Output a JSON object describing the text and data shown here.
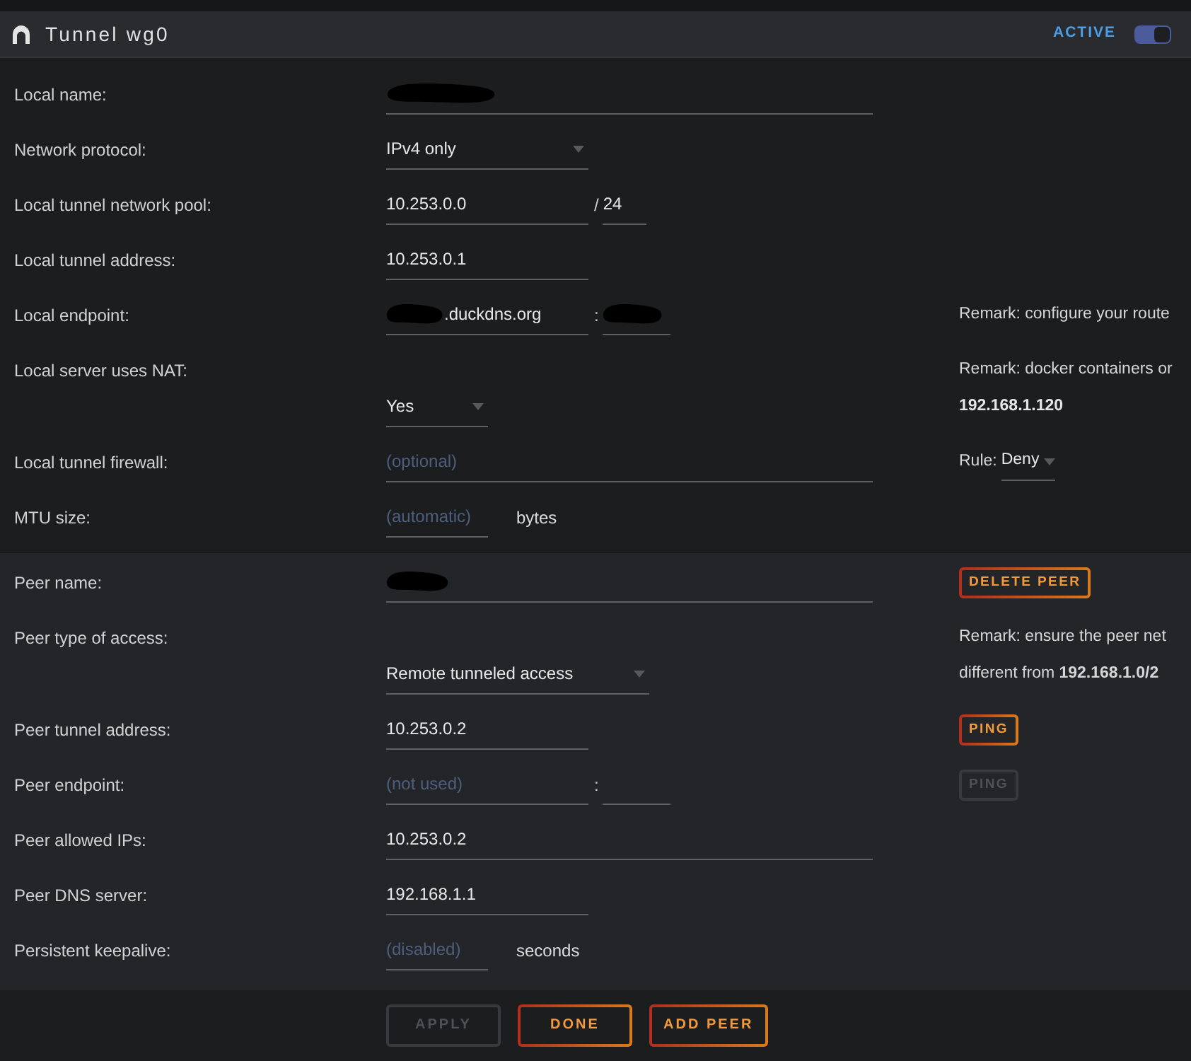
{
  "header": {
    "title": "Tunnel wg0",
    "status": "ACTIVE",
    "toggle_on": true
  },
  "sections": [
    {
      "rows": [
        {
          "label": "Local name:",
          "fields": [
            {
              "kind": "input",
              "redacted": true
            }
          ]
        },
        {
          "label": "Network protocol:",
          "fields": [
            {
              "kind": "select",
              "value": "IPv4 only"
            }
          ]
        },
        {
          "label": "Local tunnel network pool:",
          "fields": [
            {
              "kind": "input",
              "value": "10.253.0.0",
              "redacted": false
            },
            {
              "kind": "separator",
              "text": "/"
            },
            {
              "kind": "input",
              "value": "24",
              "redacted": false
            }
          ]
        },
        {
          "label": "Local tunnel address:",
          "fields": [
            {
              "kind": "input",
              "value": "10.253.0.1",
              "redacted": false
            }
          ]
        },
        {
          "label": "Local endpoint:",
          "fields": [
            {
              "kind": "input",
              "value": ".duckdns.org",
              "redacted": true
            },
            {
              "kind": "separator",
              "text": ":"
            },
            {
              "kind": "input",
              "redacted": true
            }
          ],
          "side": [
            {
              "kind": "remark",
              "text": "Remark: configure your route"
            }
          ]
        },
        {
          "label": "Local server uses NAT:",
          "fields": [
            {
              "kind": "select",
              "value": "Yes"
            }
          ],
          "side": [
            {
              "kind": "remark",
              "text": "Remark: docker containers or"
            },
            {
              "kind": "address",
              "text": "192.168.1.120"
            }
          ]
        },
        {
          "label": "Local tunnel firewall:",
          "fields": [
            {
              "kind": "input",
              "placeholder": "(optional)",
              "redacted": false
            }
          ],
          "side": [
            {
              "kind": "rule",
              "label": "Rule:",
              "value": "Deny"
            }
          ]
        },
        {
          "label": "MTU size:",
          "fields": [
            {
              "kind": "input",
              "placeholder": "(automatic)",
              "redacted": false
            },
            {
              "kind": "unit",
              "text": "bytes"
            }
          ]
        }
      ]
    },
    {
      "rows": [
        {
          "label": "Peer name:",
          "fields": [
            {
              "kind": "input",
              "redacted": true
            }
          ],
          "side": [
            {
              "kind": "button",
              "label": "DELETE PEER",
              "disabled": false
            }
          ]
        },
        {
          "label": "Peer type of access:",
          "fields": [
            {
              "kind": "select",
              "value": "Remote tunneled access"
            }
          ],
          "side": [
            {
              "kind": "remark",
              "text": "Remark: ensure the peer net"
            },
            {
              "kind": "remark",
              "text": "different from **192.168.1.0/2**"
            }
          ]
        },
        {
          "label": "Peer tunnel address:",
          "fields": [
            {
              "kind": "input",
              "value": "10.253.0.2",
              "redacted": false
            }
          ],
          "side": [
            {
              "kind": "button",
              "label": "PING",
              "disabled": false
            }
          ]
        },
        {
          "label": "Peer endpoint:",
          "fields": [
            {
              "kind": "input",
              "placeholder": "(not used)",
              "redacted": false
            },
            {
              "kind": "separator",
              "text": ":"
            },
            {
              "kind": "input",
              "redacted": false
            }
          ],
          "side": [
            {
              "kind": "button",
              "label": "PING",
              "disabled": true
            }
          ]
        },
        {
          "label": "Peer allowed IPs:",
          "fields": [
            {
              "kind": "input",
              "value": "10.253.0.2",
              "redacted": false
            }
          ]
        },
        {
          "label": "Peer DNS server:",
          "fields": [
            {
              "kind": "input",
              "value": "192.168.1.1",
              "redacted": false
            }
          ]
        },
        {
          "label": "Persistent keepalive:",
          "fields": [
            {
              "kind": "input",
              "placeholder": "(disabled)",
              "redacted": false
            },
            {
              "kind": "unit",
              "text": "seconds"
            }
          ]
        }
      ]
    }
  ],
  "footer": {
    "buttons": [
      {
        "label": "APPLY",
        "disabled": true
      },
      {
        "label": "DONE",
        "disabled": false
      },
      {
        "label": "ADD PEER",
        "disabled": false
      }
    ]
  }
}
